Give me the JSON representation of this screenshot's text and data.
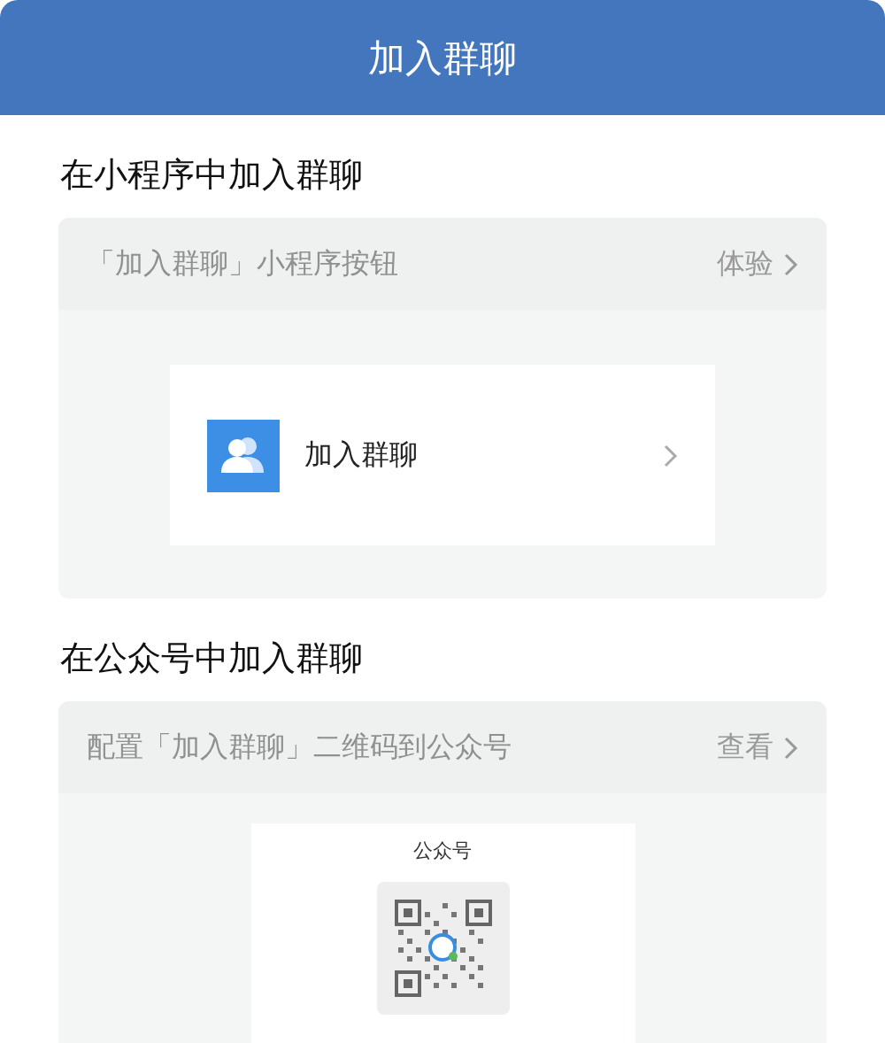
{
  "header": {
    "title": "加入群聊"
  },
  "sections": [
    {
      "title": "在小程序中加入群聊",
      "card": {
        "label": "「加入群聊」小程序按钮",
        "action": "体验",
        "kind": "button-preview",
        "preview": {
          "label": "加入群聊"
        }
      }
    },
    {
      "title": "在公众号中加入群聊",
      "card": {
        "label": "配置「加入群聊」二维码到公众号",
        "action": "查看",
        "kind": "qr-preview",
        "preview": {
          "label": "公众号"
        }
      }
    }
  ]
}
